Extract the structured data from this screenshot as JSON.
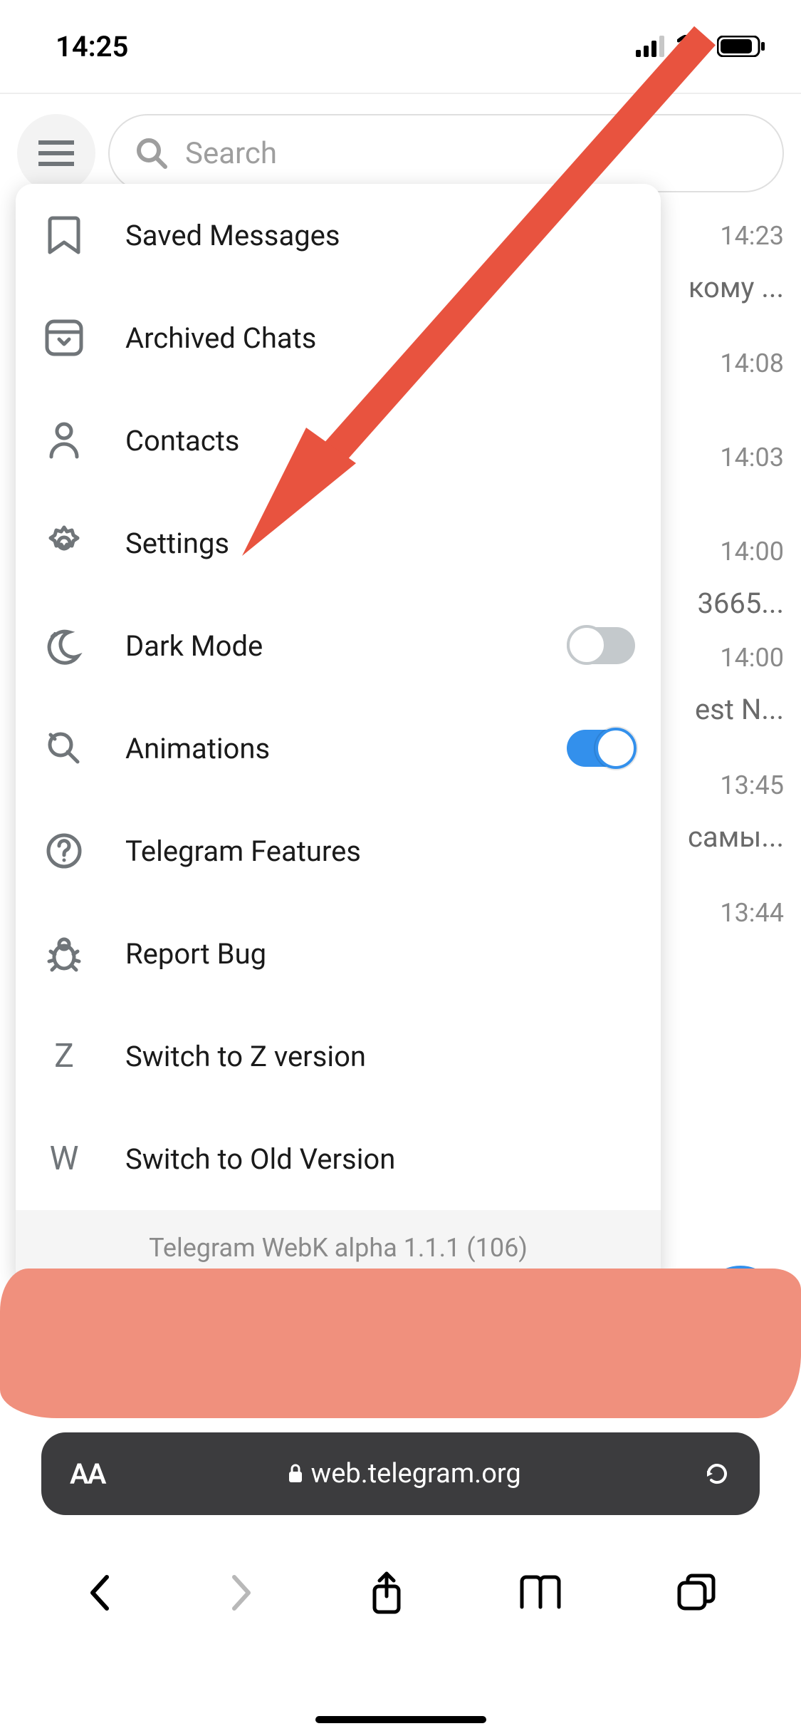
{
  "status": {
    "time": "14:25"
  },
  "search": {
    "placeholder": "Search"
  },
  "menu": {
    "items": [
      {
        "label": "Saved Messages"
      },
      {
        "label": "Archived Chats"
      },
      {
        "label": "Contacts"
      },
      {
        "label": "Settings"
      },
      {
        "label": "Dark Mode",
        "toggle": false
      },
      {
        "label": "Animations",
        "toggle": true
      },
      {
        "label": "Telegram Features"
      },
      {
        "label": "Report Bug"
      },
      {
        "label": "Switch to Z version"
      },
      {
        "label": "Switch to Old Version"
      }
    ],
    "version": "Telegram WebK alpha 1.1.1 (106)"
  },
  "chats": [
    {
      "time": "14:23",
      "snip": "кому ..."
    },
    {
      "time": "14:08",
      "snip": ""
    },
    {
      "time": "14:03",
      "snip": ""
    },
    {
      "time": "14:00",
      "snip": "3665..."
    },
    {
      "time": "14:00",
      "snip": "est N..."
    },
    {
      "time": "13:45",
      "snip": "самы..."
    },
    {
      "time": "13:44",
      "snip": ""
    }
  ],
  "safari": {
    "aa": "AA",
    "url": "web.telegram.org"
  },
  "annotation": {
    "color": "#e74c3c",
    "target": "settings"
  }
}
